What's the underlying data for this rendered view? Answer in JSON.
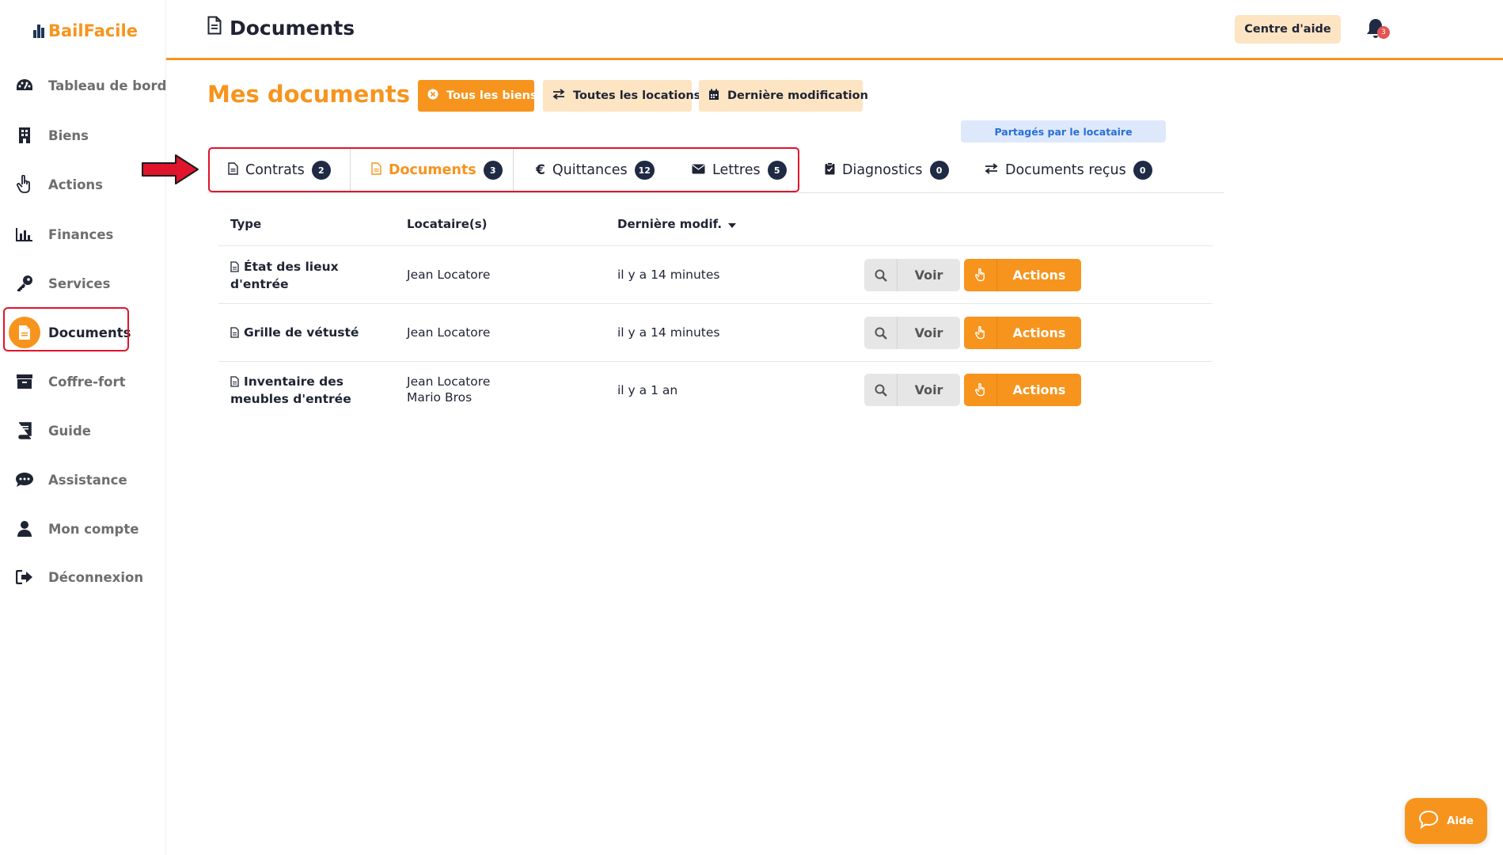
{
  "app": {
    "logo_text": "BailFacile"
  },
  "sidebar": {
    "items": [
      {
        "label": "Tableau de bord",
        "icon": "gauge-icon"
      },
      {
        "label": "Biens",
        "icon": "building-icon"
      },
      {
        "label": "Actions",
        "icon": "hand-pointer-icon"
      },
      {
        "label": "Finances",
        "icon": "bar-chart-icon"
      },
      {
        "label": "Services",
        "icon": "key-icon"
      },
      {
        "label": "Documents",
        "icon": "file-icon",
        "active": true
      },
      {
        "label": "Coffre-fort",
        "icon": "archive-icon"
      },
      {
        "label": "Guide",
        "icon": "book-icon"
      },
      {
        "label": "Assistance",
        "icon": "chat-icon"
      },
      {
        "label": "Mon compte",
        "icon": "user-icon"
      },
      {
        "label": "Déconnexion",
        "icon": "sign-out-icon"
      }
    ]
  },
  "header": {
    "title": "Documents",
    "help_center": "Centre d'aide",
    "notifications_count": "3"
  },
  "page": {
    "heading": "Mes documents",
    "filters": {
      "all_properties": "Tous les biens",
      "all_rentals": "Toutes les locations",
      "last_modified": "Dernière modification"
    },
    "shared_by_tenant": "Partagés par le locataire"
  },
  "tabs": [
    {
      "label": "Contrats",
      "count": "2",
      "icon": "file-icon"
    },
    {
      "label": "Documents",
      "count": "3",
      "icon": "file-icon",
      "active": true
    },
    {
      "label": "Quittances",
      "count": "12",
      "icon": "euro-icon"
    },
    {
      "label": "Lettres",
      "count": "5",
      "icon": "envelope-icon"
    },
    {
      "label": "Diagnostics",
      "count": "0",
      "icon": "clipboard-check-icon"
    },
    {
      "label": "Documents reçus",
      "count": "0",
      "icon": "exchange-icon"
    }
  ],
  "table": {
    "headers": {
      "type": "Type",
      "tenants": "Locataire(s)",
      "modified": "Dernière modif."
    },
    "rows": [
      {
        "type_line1": "État des lieux",
        "type_line2": "d'entrée",
        "tenant1": "Jean Locatore",
        "tenant2": "",
        "modified": "il y a 14 minutes"
      },
      {
        "type_line1": "Grille de vétusté",
        "type_line2": "",
        "tenant1": "Jean Locatore",
        "tenant2": "",
        "modified": "il y a 14 minutes"
      },
      {
        "type_line1": "Inventaire des",
        "type_line2": "meubles d'entrée",
        "tenant1": "Jean Locatore",
        "tenant2": "Mario Bros",
        "modified": "il y a 1 an"
      }
    ],
    "view_label": "Voir",
    "actions_label": "Actions"
  },
  "floating": {
    "help_label": "Aide"
  },
  "colors": {
    "accent": "#f7941d",
    "accent_light": "#fde4c3",
    "navy": "#1f2a44",
    "annotation_red": "#e0142b"
  }
}
